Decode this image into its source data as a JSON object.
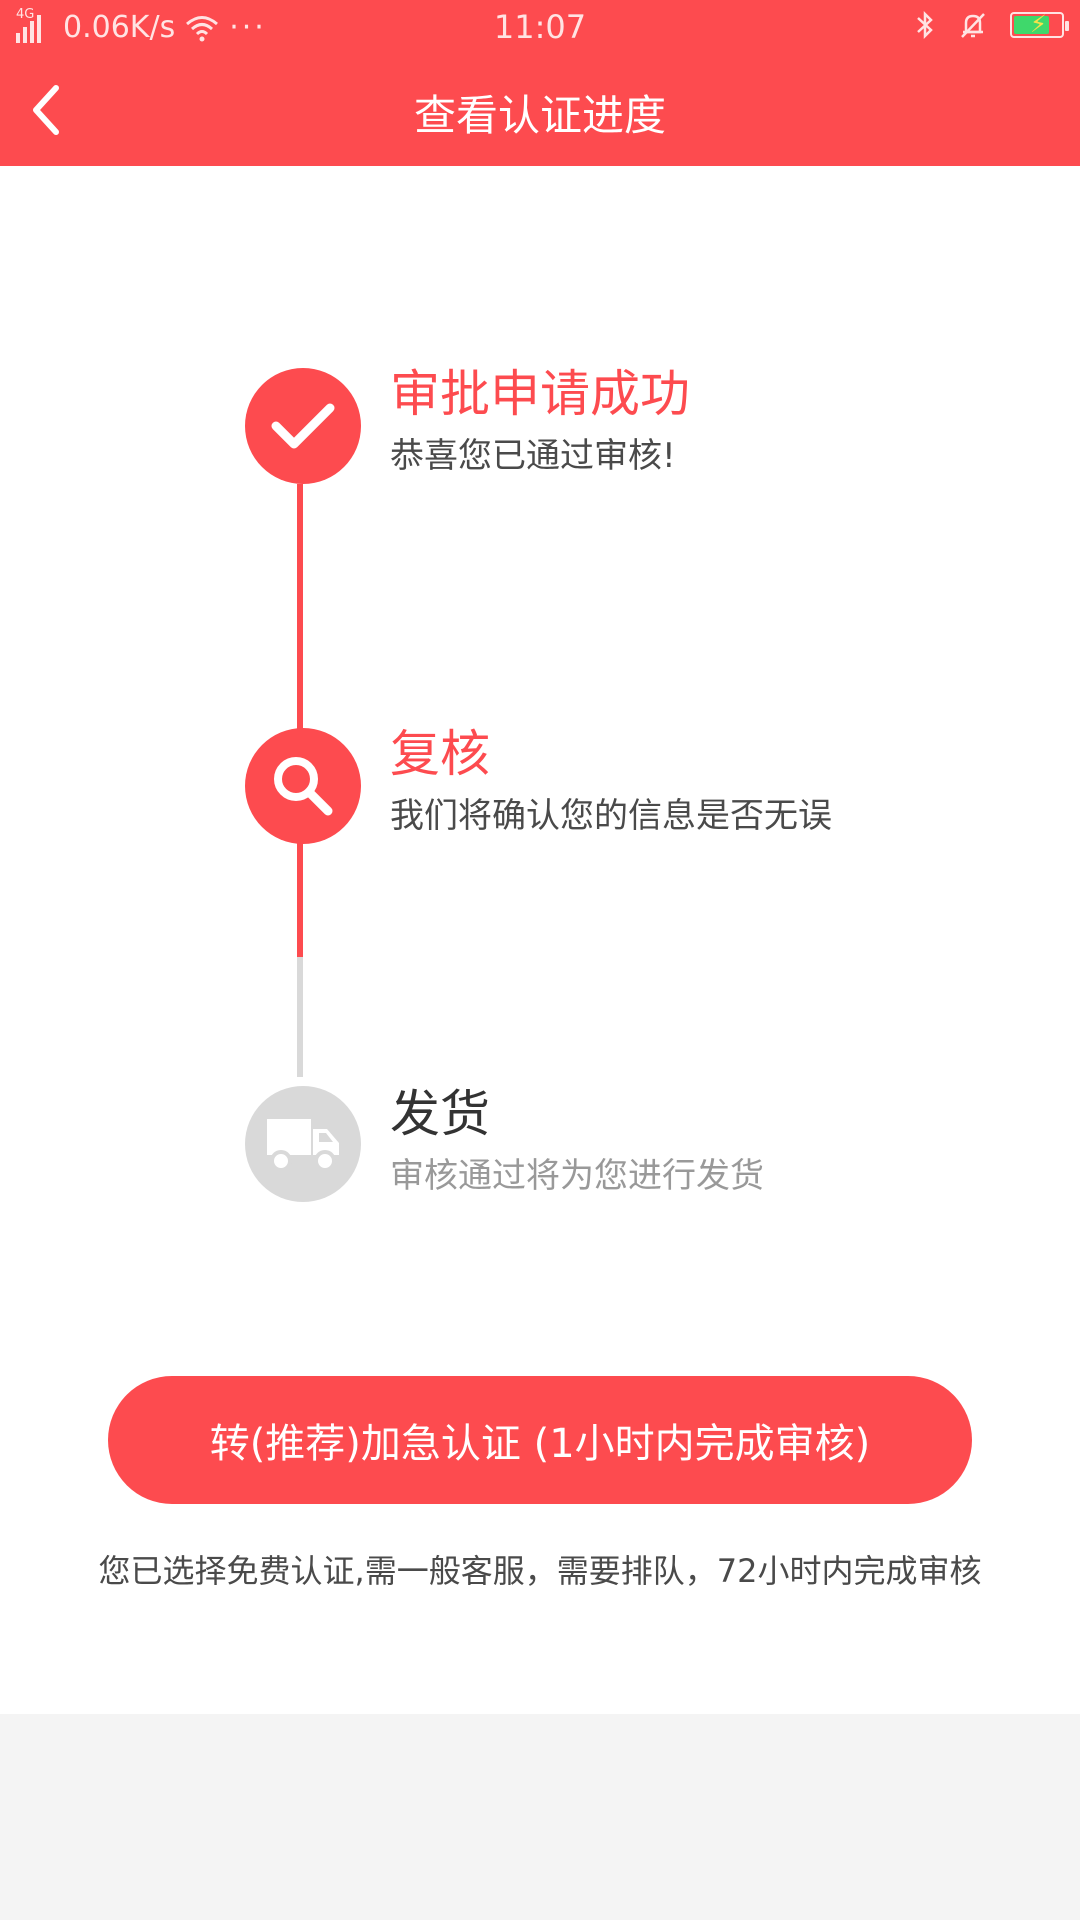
{
  "status_bar": {
    "network": "4G",
    "speed": "0.06K/s",
    "more": "···",
    "time": "11:07",
    "battery_level": 0.75,
    "icons": [
      "signal-icon",
      "wifi-icon",
      "bluetooth-icon",
      "bell-muted-icon",
      "battery-charging-icon"
    ]
  },
  "header": {
    "back_icon": "chevron-left-icon",
    "title": "查看认证进度"
  },
  "colors": {
    "accent": "#fd4b4f",
    "inactive": "#d9d9d9",
    "text_dark": "#333333",
    "text_gray": "#999999"
  },
  "steps": [
    {
      "icon": "check-icon",
      "title": "审批申请成功",
      "desc": "恭喜您已通过审核!",
      "state": "done"
    },
    {
      "icon": "search-icon",
      "title": "复核",
      "desc": "我们将确认您的信息是否无误",
      "state": "current"
    },
    {
      "icon": "truck-icon",
      "title": "发货",
      "desc": "审核通过将为您进行发货",
      "state": "pending"
    }
  ],
  "action": {
    "button_label": "转(推荐)加急认证 (1小时内完成审核)",
    "note": "您已选择免费认证,需一般客服，需要排队，72小时内完成审核"
  }
}
